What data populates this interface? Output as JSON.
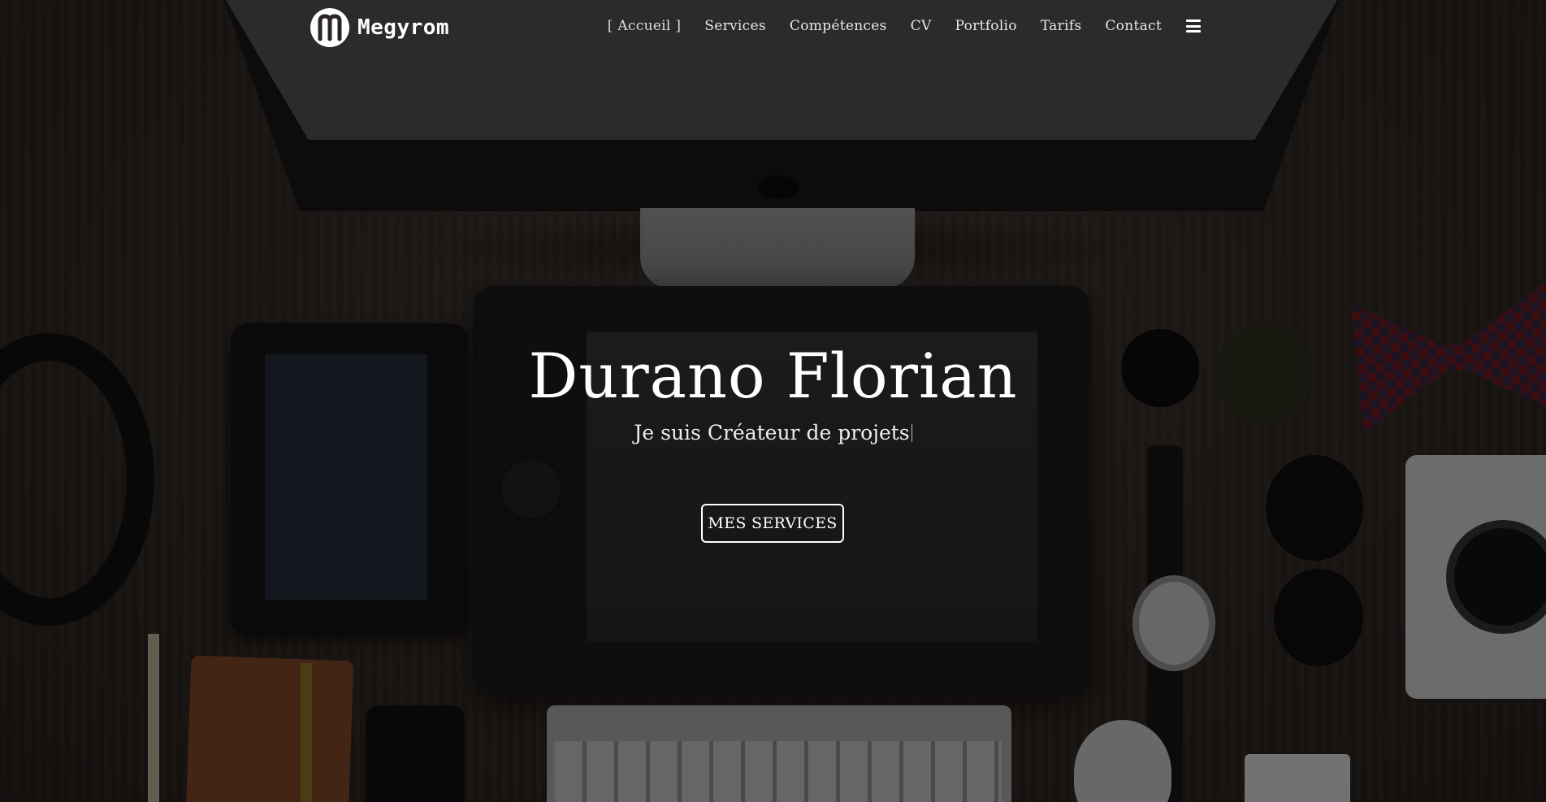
{
  "brand": {
    "logo_text": "Megyrom"
  },
  "nav": {
    "items": [
      {
        "label": "[ Accueil ]",
        "active": true
      },
      {
        "label": "Services",
        "active": false
      },
      {
        "label": "Compétences",
        "active": false
      },
      {
        "label": "CV",
        "active": false
      },
      {
        "label": "Portfolio",
        "active": false
      },
      {
        "label": "Tarifs",
        "active": false
      },
      {
        "label": "Contact",
        "active": false
      }
    ],
    "menu_icon": "hamburger-menu-icon"
  },
  "hero": {
    "title": "Durano Florian",
    "subtitle": "Je suis Créateur de projets",
    "button_label": "MES SERVICES"
  },
  "colors": {
    "text": "#ffffff",
    "overlay": "rgba(0,0,0,0.52)"
  }
}
